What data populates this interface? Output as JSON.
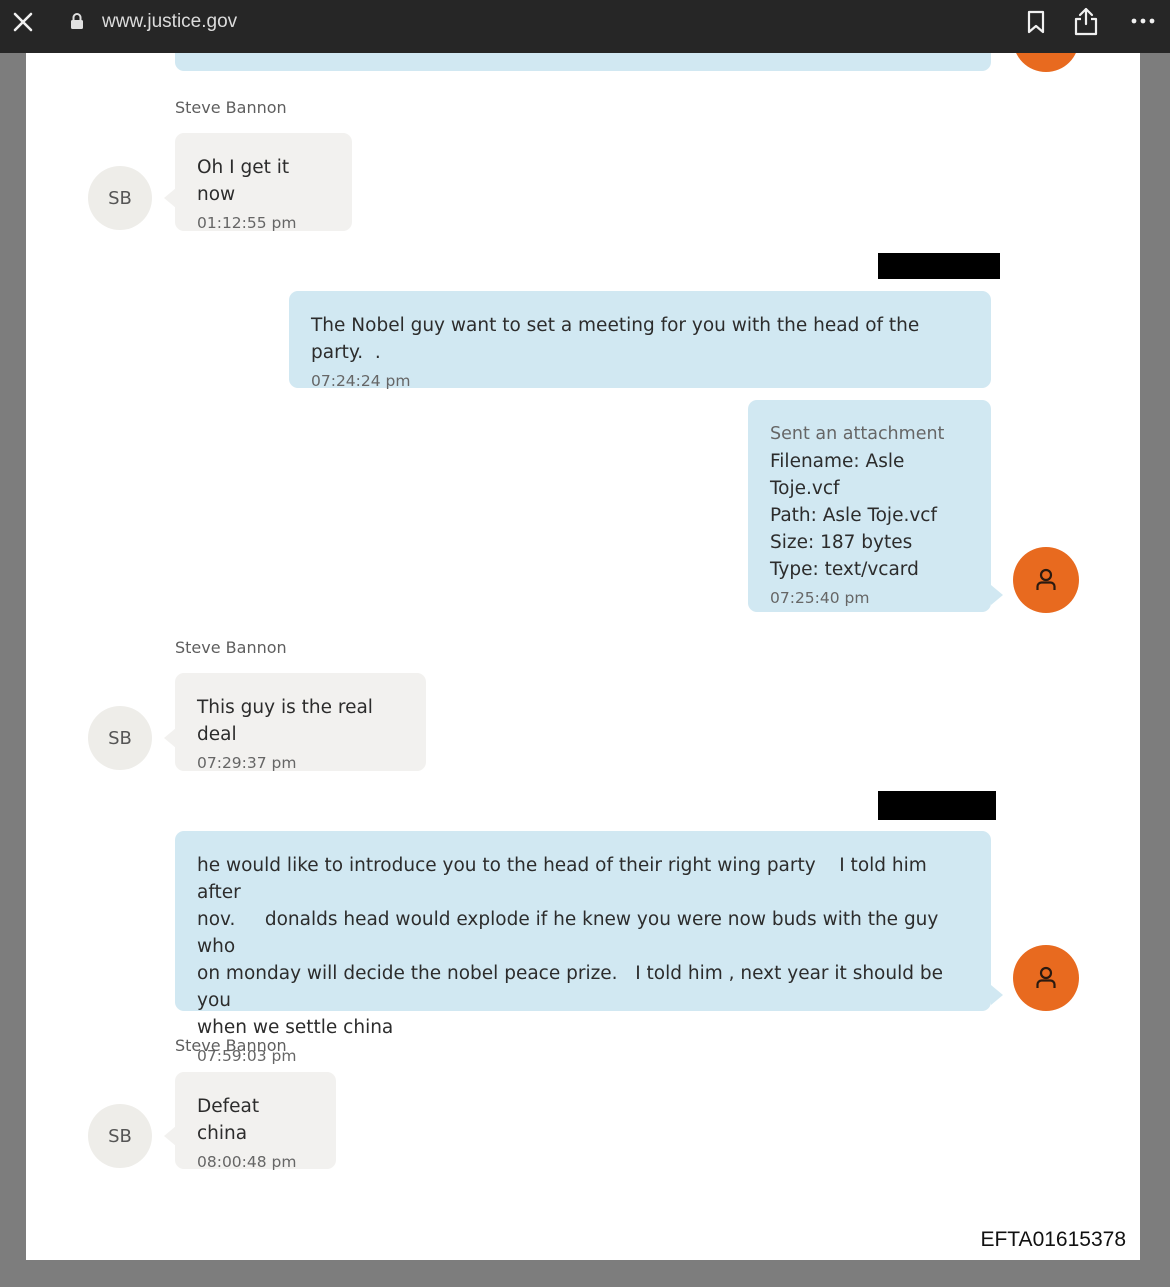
{
  "browser": {
    "url": "www.justice.gov"
  },
  "conversation": {
    "contact_name": "Steve Bannon",
    "contact_initials": "SB",
    "messages": [
      {
        "direction": "incoming",
        "sender": "Steve Bannon",
        "text": "Oh I get it now",
        "time": "01:12:55 pm"
      },
      {
        "direction": "outgoing",
        "sender": "[redacted]",
        "text": "The Nobel guy want to set a meeting for you with the head of the party.  .",
        "time": "07:24:24 pm"
      },
      {
        "direction": "outgoing",
        "attachment": {
          "header": "Sent an attachment",
          "filename": "Filename: Asle Toje.vcf",
          "path": "Path: Asle Toje.vcf",
          "size": "Size: 187 bytes",
          "type": "Type: text/vcard"
        },
        "time": "07:25:40 pm"
      },
      {
        "direction": "incoming",
        "sender": "Steve Bannon",
        "text": "This guy is the real deal",
        "time": "07:29:37 pm"
      },
      {
        "direction": "outgoing",
        "sender": "[redacted]",
        "text": "he would like to introduce you to the head of their right wing party    I told him after\nnov.     donalds head would explode if he knew you were now buds with the guy who\non monday will decide the nobel peace prize.   I told him , next year it should be you\nwhen we settle china",
        "time": "07:59:03 pm"
      },
      {
        "direction": "incoming",
        "sender": "Steve Bannon",
        "text": "Defeat china",
        "time": "08:00:48 pm"
      }
    ]
  },
  "document_id": "EFTA01615378",
  "colors": {
    "outgoing_bubble": "#d1e8f2",
    "incoming_bubble": "#f2f1ef",
    "user_avatar": "#e86a1f",
    "browser_bar": "#262626"
  }
}
